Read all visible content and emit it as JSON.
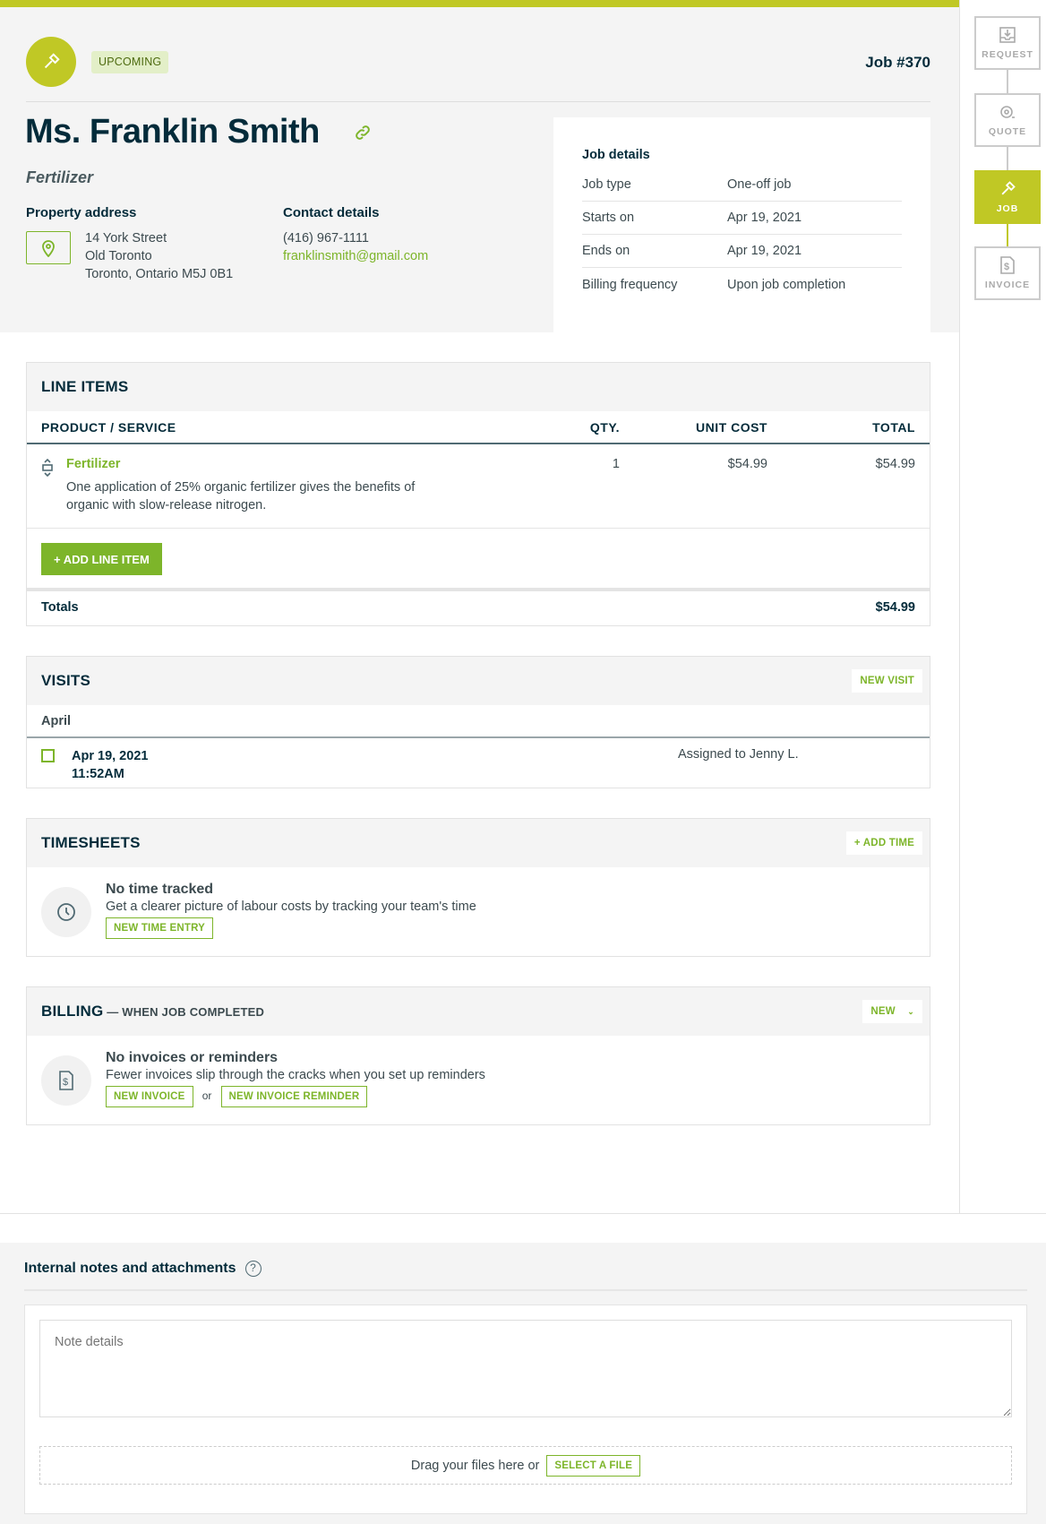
{
  "header": {
    "status_badge": "UPCOMING",
    "job_number": "Job #370",
    "client_name": "Ms. Franklin Smith",
    "job_title": "Fertilizer",
    "property_label": "Property address",
    "address": [
      "14 York Street",
      "Old Toronto",
      "Toronto, Ontario M5J 0B1"
    ],
    "contact_label": "Contact details",
    "phone": "(416) 967-1111",
    "email": "franklinsmith@gmail.com"
  },
  "job_details": {
    "title": "Job details",
    "rows": [
      {
        "k": "Job type",
        "v": "One-off job"
      },
      {
        "k": "Starts on",
        "v": "Apr 19, 2021"
      },
      {
        "k": "Ends on",
        "v": "Apr 19, 2021"
      },
      {
        "k": "Billing frequency",
        "v": "Upon job completion"
      }
    ]
  },
  "workflow": {
    "steps": [
      {
        "label": "REQUEST",
        "icon": "inbox-download-icon"
      },
      {
        "label": "QUOTE",
        "icon": "measuring-tape-icon"
      },
      {
        "label": "JOB",
        "icon": "hammer-icon",
        "active": true
      },
      {
        "label": "INVOICE",
        "icon": "invoice-dollar-icon"
      }
    ]
  },
  "line_items": {
    "title": "LINE ITEMS",
    "columns": [
      "PRODUCT / SERVICE",
      "QTY.",
      "UNIT COST",
      "TOTAL"
    ],
    "items": [
      {
        "name": "Fertilizer",
        "description": "One application of 25% organic fertilizer gives the benefits of organic with slow-release nitrogen.",
        "qty": "1",
        "unit_cost": "$54.99",
        "total": "$54.99"
      }
    ],
    "add_label": "+  ADD LINE ITEM",
    "totals_label": "Totals",
    "totals_value": "$54.99"
  },
  "visits": {
    "title": "VISITS",
    "new_label": "NEW VISIT",
    "month": "April",
    "items": [
      {
        "date": "Apr 19, 2021",
        "time": "11:52AM",
        "assigned": "Assigned to Jenny L."
      }
    ]
  },
  "timesheets": {
    "title": "TIMESHEETS",
    "add_label": "+ ADD TIME",
    "empty_title": "No time tracked",
    "empty_text": "Get a clearer picture of labour costs by tracking your team's time",
    "entry_label": "NEW TIME ENTRY"
  },
  "billing": {
    "title": "BILLING",
    "subtitle": " — WHEN JOB COMPLETED",
    "new_label": "NEW",
    "empty_title": "No invoices or reminders",
    "empty_text": "Fewer invoices slip through the cracks when you set up reminders",
    "invoice_label": "NEW INVOICE",
    "or": "or",
    "reminder_label": "NEW INVOICE REMINDER"
  },
  "notes": {
    "title": "Internal notes and attachments",
    "placeholder": "Note details",
    "drop_text": "Drag your files here or",
    "select_label": "SELECT A FILE"
  }
}
